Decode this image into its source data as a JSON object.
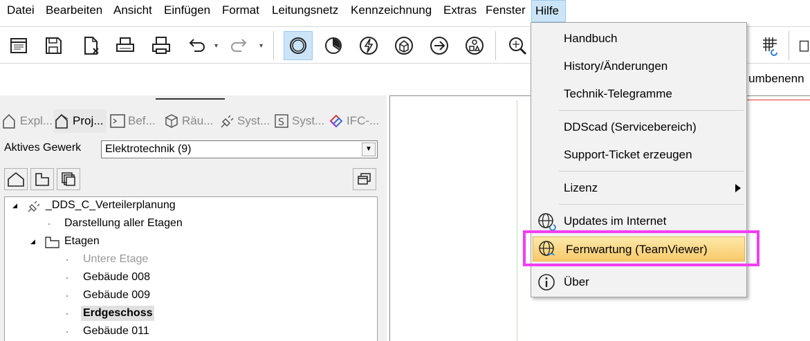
{
  "menubar": {
    "items": [
      "Datei",
      "Bearbeiten",
      "Ansicht",
      "Einfügen",
      "Format",
      "Leitungsnetz",
      "Kennzeichnung",
      "Extras",
      "Fenster",
      "Hilfe"
    ]
  },
  "toolbar": {
    "icons": [
      "document-list-icon",
      "save-icon",
      "close-document-icon",
      "print-preview-icon",
      "printer-icon",
      "undo-icon",
      "redo-icon",
      "circle-icon",
      "pie-chart-icon",
      "lightning-icon",
      "cube-house-icon",
      "arrow-right-icon",
      "shapes-icon",
      "zoom-icon",
      "grid-icon"
    ],
    "undo_dropdown": "▾",
    "redo_dropdown": "▾"
  },
  "document_title_fragment": "n umbenenn",
  "panel": {
    "tabs": [
      "Expl...",
      "Proj...",
      "Bef...",
      "Räu...",
      "Syst...",
      "Syst...",
      "IFC-..."
    ],
    "gewerk_label": "Aktives Gewerk",
    "gewerk_value": "Elektrotechnik (9)"
  },
  "tree": {
    "root": "_DDS_C_Verteilerplanung",
    "all_floors": "Darstellung aller Etagen",
    "etagen": "Etagen",
    "children": [
      "Untere Etage",
      "Gebäude 008",
      "Gebäude 009",
      "Erdgeschoss",
      "Gebäude 011"
    ]
  },
  "hilfe_menu": {
    "items": [
      "Handbuch",
      "History/Änderungen",
      "Technik-Telegramme",
      "DDScad (Servicebereich)",
      "Support-Ticket erzeugen",
      "Lizenz",
      "Updates im Internet",
      "Fernwartung (TeamViewer)",
      "Über"
    ]
  },
  "colors": {
    "menu_highlight": "#cce4f7",
    "item_highlight": "#f9c96b",
    "annotation_frame": "#f23ef2"
  }
}
